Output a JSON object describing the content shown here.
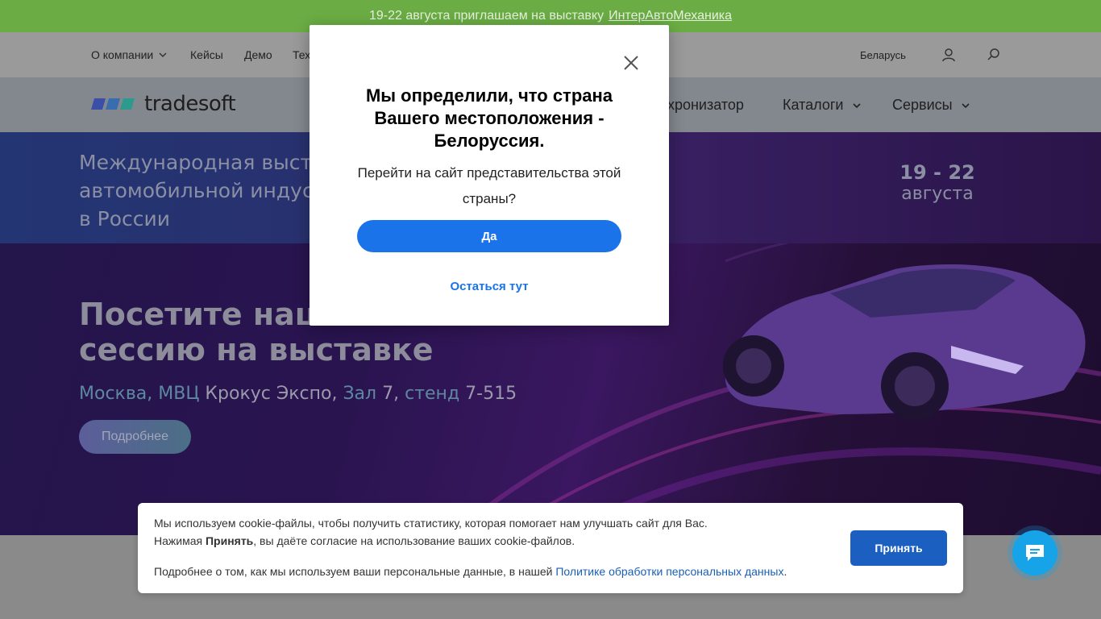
{
  "announcement": {
    "text": "19-22 августа приглашаем на выставку",
    "link": "ИнтерАвтоМеханика"
  },
  "topnav": {
    "items": [
      "О компании",
      "Кейсы",
      "Демо",
      "Тех"
    ],
    "country": "Беларусь",
    "icons": [
      "user-icon",
      "search-icon"
    ]
  },
  "header": {
    "logo_text": "tradesoft",
    "menu": [
      "нхронизатор",
      "Каталоги",
      "Сервисы"
    ]
  },
  "hero": {
    "title_lines": [
      "Международная выст",
      "автомобильной индус",
      "в России"
    ],
    "date_range": "19 - 22",
    "date_month": "августа",
    "headline_lines": [
      "Посетите наш",
      "сессию на выставке"
    ],
    "location": {
      "city": "Москва,",
      "venue_prefix": "МВЦ",
      "venue": "Крокус Экспо,",
      "hall_label": "Зал",
      "hall": "7,",
      "stand_label": "стенд",
      "stand": "7-515"
    },
    "button": "Подробнее"
  },
  "cookie": {
    "line1": "Мы используем cookie-файлы, чтобы получить статистику, которая помогает нам улучшать сайт для Вас.",
    "line2_pre": "Нажимая",
    "line2_bold": "Принять",
    "line2_post": ", вы даёте согласие на использование ваших cookie-файлов.",
    "line3_pre": "Подробнее о том, как мы используем ваши персональные данные, в нашей",
    "line3_link": "Политике обработки персональных данных",
    "line3_post": ".",
    "accept": "Принять"
  },
  "modal": {
    "title": "Мы определили, что страна Вашего местоположения - Белоруссия.",
    "text": "Перейти на сайт представительства этой страны?",
    "yes": "Да",
    "stay": "Остаться тут"
  },
  "colors": {
    "announcement_bg": "#6bad44",
    "primary_blue": "#1a73e8",
    "accept_blue": "#1b5fc0",
    "chat_blue": "#16a3e8"
  }
}
